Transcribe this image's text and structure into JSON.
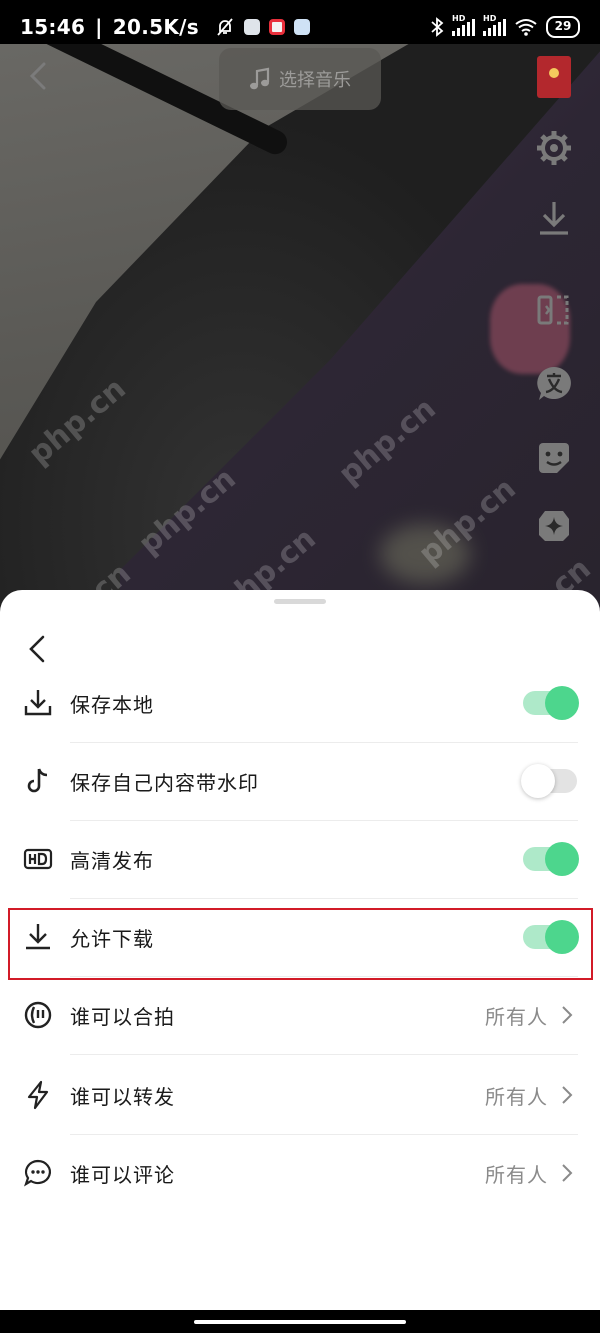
{
  "status_bar": {
    "time": "15:46",
    "separator": "|",
    "network_speed": "20.5K/s",
    "hd_label": "HD",
    "battery_level": "29"
  },
  "preview": {
    "music_button_label": "选择音乐",
    "watermark_text": "php.cn"
  },
  "sheet": {
    "rows": [
      {
        "label": "保存本地",
        "control": "toggle",
        "enabled": true,
        "icon": "download-icon"
      },
      {
        "label": "保存自己内容带水印",
        "control": "toggle",
        "enabled": false,
        "icon": "tiktok-icon"
      },
      {
        "label": "高清发布",
        "control": "toggle",
        "enabled": true,
        "icon": "hd-icon"
      },
      {
        "label": "允许下载",
        "control": "toggle",
        "enabled": true,
        "icon": "download-icon",
        "highlighted": true
      },
      {
        "label": "谁可以合拍",
        "control": "select",
        "value": "所有人",
        "icon": "duet-icon"
      },
      {
        "label": "谁可以转发",
        "control": "select",
        "value": "所有人",
        "icon": "lightning-icon"
      },
      {
        "label": "谁可以评论",
        "control": "select",
        "value": "所有人",
        "icon": "comment-icon"
      }
    ]
  },
  "colors": {
    "toggle_on_track": "#aee9c9",
    "toggle_on_knob": "#4dd68d",
    "highlight_border": "#d21b28"
  }
}
